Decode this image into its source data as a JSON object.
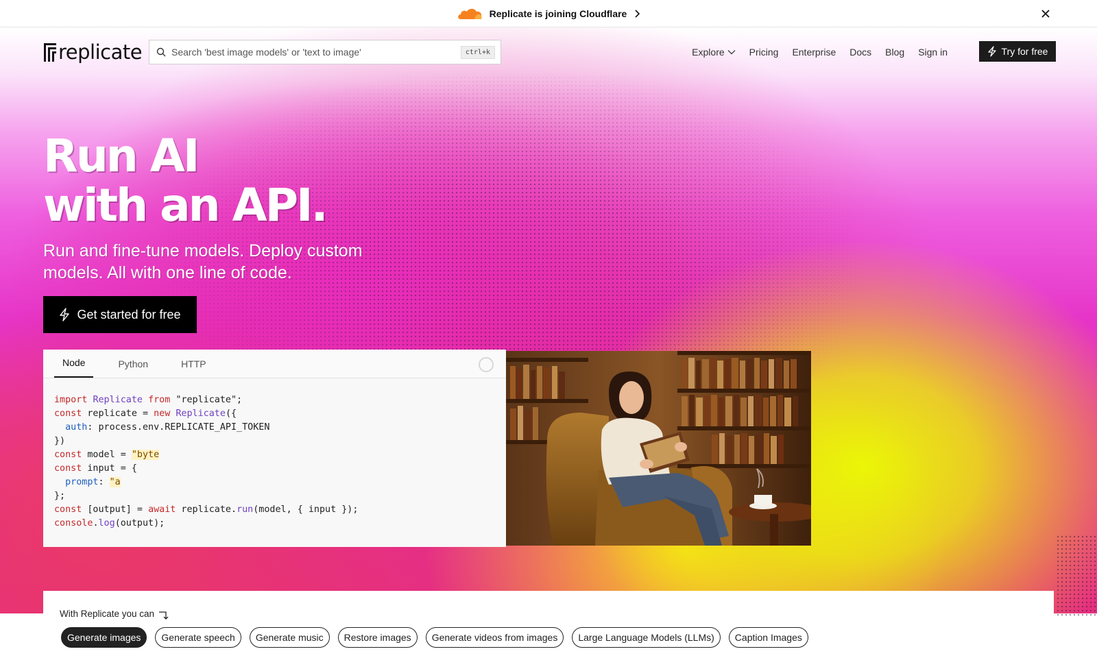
{
  "announcement": {
    "text": "Replicate is joining Cloudflare",
    "cloud_icon": "cloudflare-cloud-icon",
    "cloud_colors": [
      "#f6821f",
      "#fbad41"
    ]
  },
  "nav": {
    "logo_text": "replicate",
    "search_placeholder": "Search 'best image models' or 'text to image'",
    "search_shortcut": "ctrl+k",
    "links": [
      "Explore",
      "Pricing",
      "Enterprise",
      "Docs",
      "Blog",
      "Sign in"
    ],
    "try_label": "Try for free"
  },
  "hero": {
    "headline_line1": "Run AI",
    "headline_line2": "with an API.",
    "subhead": "Run and fine-tune models. Deploy custom models. All with one line of code.",
    "cta_label": "Get started for free"
  },
  "code": {
    "tabs": [
      "Node",
      "Python",
      "HTTP"
    ],
    "active_tab": "Node",
    "lines": [
      "import Replicate from \"replicate\";",
      "const replicate = new Replicate({",
      "  auth: process.env.REPLICATE_API_TOKEN",
      "})",
      "const model = \"byte",
      "const input = {",
      "  prompt: \"a",
      "};",
      "const [output] = await replicate.run(model, { input });",
      "console.log(output);"
    ]
  },
  "photo": {
    "description_icon": "woman-reading-in-library-image"
  },
  "capabilities": {
    "lead": "With Replicate you can",
    "items": [
      "Generate images",
      "Generate speech",
      "Generate music",
      "Restore images",
      "Generate videos from images",
      "Large Language Models (LLMs)",
      "Caption Images"
    ],
    "active": "Generate images"
  },
  "colors": {
    "accent_dark": "#1c1c1c",
    "hero_pink": "#e634c8",
    "hero_yellow": "#ebff00"
  }
}
